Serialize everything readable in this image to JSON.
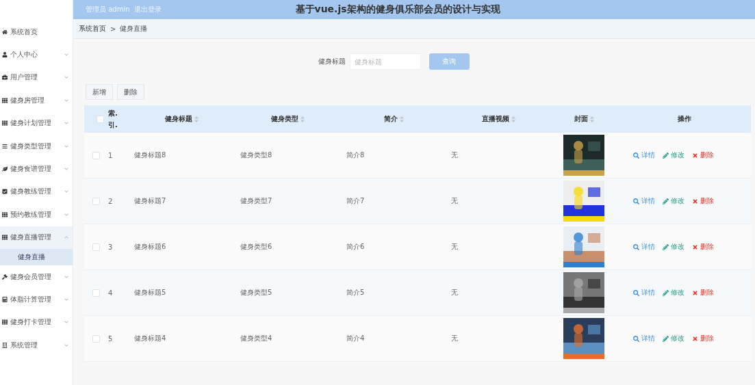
{
  "header": {
    "user_label": "管理员 admin",
    "logout": "退出登录",
    "title": "基于vue.js架构的健身俱乐部会员的设计与实现"
  },
  "sidebar": {
    "items": [
      {
        "label": "系统首页",
        "kind": "link"
      },
      {
        "label": "个人中心",
        "kind": "menu",
        "expanded": false
      },
      {
        "label": "用户管理",
        "kind": "menu",
        "expanded": false
      },
      {
        "label": "健身房管理",
        "kind": "menu",
        "expanded": false
      },
      {
        "label": "健身计划管理",
        "kind": "menu",
        "expanded": false
      },
      {
        "label": "健身类型管理",
        "kind": "menu",
        "expanded": false
      },
      {
        "label": "健身食谱管理",
        "kind": "menu",
        "expanded": false
      },
      {
        "label": "健身教练管理",
        "kind": "menu",
        "expanded": false
      },
      {
        "label": "预约教练管理",
        "kind": "menu",
        "expanded": false
      },
      {
        "label": "健身直播管理",
        "kind": "menu",
        "expanded": true,
        "children": [
          {
            "label": "健身直播",
            "selected": true
          }
        ]
      },
      {
        "label": "健身会员管理",
        "kind": "menu",
        "expanded": false
      },
      {
        "label": "体脂计算管理",
        "kind": "menu",
        "expanded": false
      },
      {
        "label": "健身打卡管理",
        "kind": "menu",
        "expanded": false
      },
      {
        "label": "系统管理",
        "kind": "menu",
        "expanded": false
      }
    ]
  },
  "breadcrumb": [
    "系统首页",
    ">",
    "健身直播"
  ],
  "search": {
    "label": "健身标题",
    "placeholder": "健身标题",
    "button": "查询"
  },
  "actions": [
    "新增",
    "删除"
  ],
  "table": {
    "select_all_checked": false,
    "columns": [
      {
        "label": "索.引.",
        "sortable": false
      },
      {
        "label": "健身标题",
        "sortable": true
      },
      {
        "label": "健身类型",
        "sortable": true
      },
      {
        "label": "简介",
        "sortable": true
      },
      {
        "label": "直播视频",
        "sortable": true
      },
      {
        "label": "封面",
        "sortable": true
      },
      {
        "label": "操作",
        "sortable": false
      }
    ],
    "rows": [
      {
        "checked": false,
        "index": "1",
        "title": "健身标题8",
        "type": "健身类型8",
        "intro": "简介8",
        "video": "无",
        "actions": [
          {
            "label": "详情",
            "kind": "view"
          },
          {
            "label": "修改",
            "kind": "edit"
          },
          {
            "label": "删除",
            "kind": "delete"
          }
        ]
      },
      {
        "checked": false,
        "index": "2",
        "title": "健身标题7",
        "type": "健身类型7",
        "intro": "简介7",
        "video": "无",
        "actions": [
          {
            "label": "详情",
            "kind": "view"
          },
          {
            "label": "修改",
            "kind": "edit"
          },
          {
            "label": "删除",
            "kind": "delete"
          }
        ]
      },
      {
        "checked": false,
        "index": "3",
        "title": "健身标题6",
        "type": "健身类型6",
        "intro": "简介6",
        "video": "无",
        "actions": [
          {
            "label": "详情",
            "kind": "view"
          },
          {
            "label": "修改",
            "kind": "edit"
          },
          {
            "label": "删除",
            "kind": "delete"
          }
        ]
      },
      {
        "checked": false,
        "index": "4",
        "title": "健身标题5",
        "type": "健身类型5",
        "intro": "简介5",
        "video": "无",
        "actions": [
          {
            "label": "详情",
            "kind": "view"
          },
          {
            "label": "修改",
            "kind": "edit"
          },
          {
            "label": "删除",
            "kind": "delete"
          }
        ]
      },
      {
        "checked": false,
        "index": "5",
        "title": "健身标题4",
        "type": "健身类型4",
        "intro": "简介4",
        "video": "无",
        "actions": [
          {
            "label": "详情",
            "kind": "view"
          },
          {
            "label": "修改",
            "kind": "edit"
          },
          {
            "label": "删除",
            "kind": "delete"
          }
        ]
      }
    ]
  }
}
